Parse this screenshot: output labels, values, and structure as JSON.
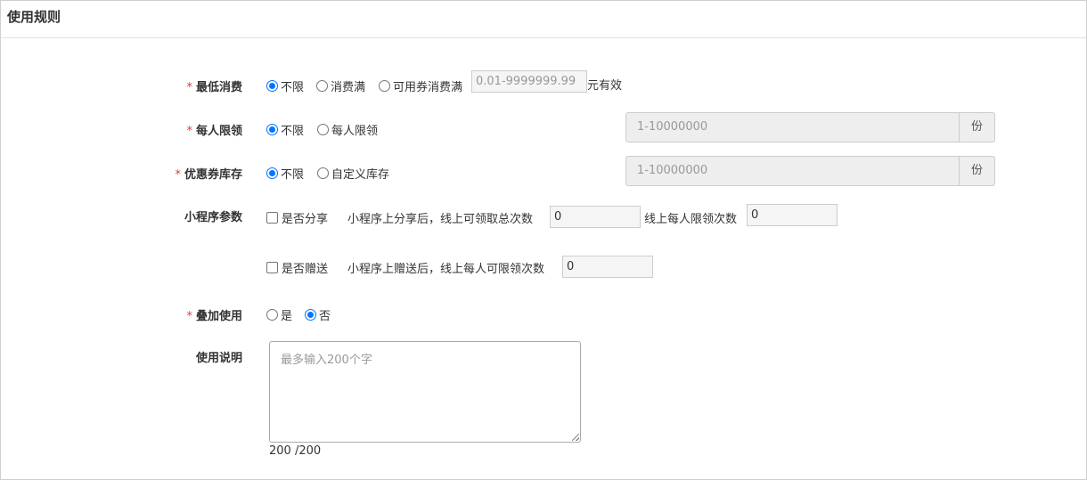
{
  "panel": {
    "title": "使用规则"
  },
  "form": {
    "min_spend": {
      "required": "*",
      "label": "最低消费",
      "options": [
        "不限",
        "消费满",
        "可用券消费满"
      ],
      "selected": "不限",
      "input_placeholder": "0.01-9999999.99",
      "suffix": "元有效"
    },
    "per_person_limit": {
      "required": "*",
      "label": "每人限领",
      "options": [
        "不限",
        "每人限领"
      ],
      "selected": "不限",
      "input_placeholder": "1-10000000",
      "unit": "份"
    },
    "coupon_stock": {
      "required": "*",
      "label": "优惠券库存",
      "options": [
        "不限",
        "自定义库存"
      ],
      "selected": "不限",
      "input_placeholder": "1-10000000",
      "unit": "份"
    },
    "mini_program": {
      "label": "小程序参数",
      "share": {
        "checkbox_label": "是否分享",
        "total_label": "小程序上分享后，线上可领取总次数",
        "total_value": "0",
        "per_person_label": "线上每人限领次数",
        "per_person_value": "0"
      },
      "gift": {
        "checkbox_label": "是否赠送",
        "per_person_label": "小程序上赠送后，线上每人可限领次数",
        "per_person_value": "0"
      }
    },
    "stackable": {
      "required": "*",
      "label": "叠加使用",
      "options": [
        "是",
        "否"
      ],
      "selected": "否"
    },
    "description": {
      "label": "使用说明",
      "placeholder": "最多输入200个字",
      "counter": "200 /200"
    }
  },
  "colors": {
    "required_star": "#e4393c",
    "radio_selected": "#0075ff"
  }
}
